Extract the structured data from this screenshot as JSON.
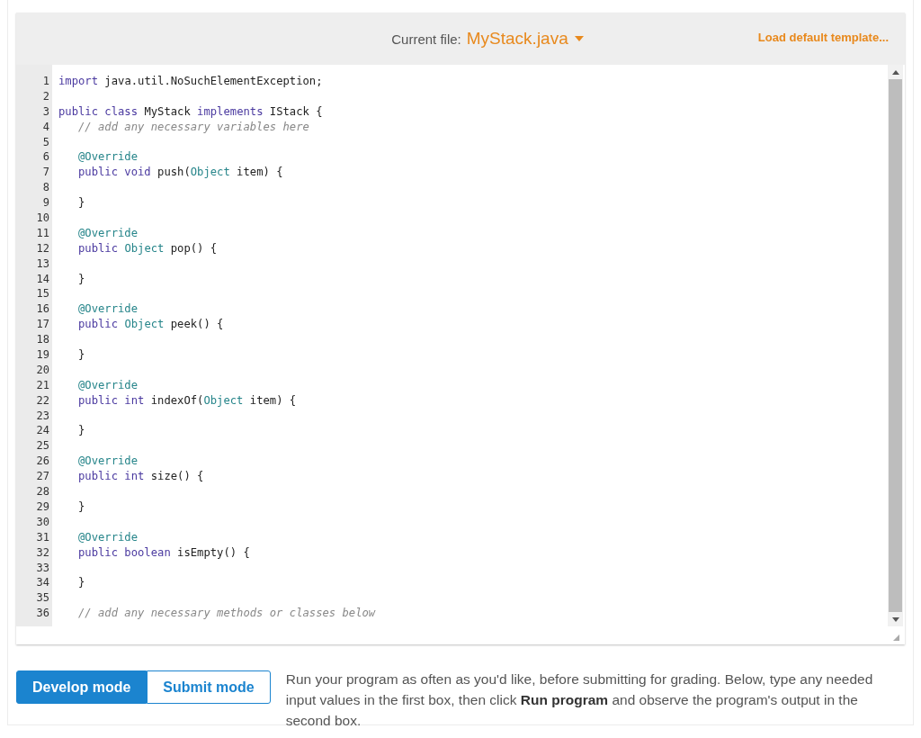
{
  "header": {
    "label": "Current file:",
    "file": "MyStack.java",
    "load_link": "Load default template..."
  },
  "code_lines": [
    {
      "number": "1",
      "tokens": [
        {
          "kind": "keyword",
          "text": "import"
        },
        {
          "kind": "text",
          "text": " java.util.NoSuchElementException;"
        }
      ]
    },
    {
      "number": "2"
    },
    {
      "number": "3",
      "tokens": [
        {
          "kind": "keyword",
          "text": "public class"
        },
        {
          "kind": "text",
          "text": " MyStack "
        },
        {
          "kind": "keyword",
          "text": "implements"
        },
        {
          "kind": "text",
          "text": " IStack {"
        }
      ]
    },
    {
      "number": "4",
      "indent": true,
      "tokens": [
        {
          "kind": "comment",
          "text": "// add any necessary variables here"
        }
      ]
    },
    {
      "number": "5"
    },
    {
      "number": "6",
      "indent": true,
      "tokens": [
        {
          "kind": "meta",
          "text": "@Override"
        }
      ]
    },
    {
      "number": "7",
      "indent": true,
      "tokens": [
        {
          "kind": "keyword",
          "text": "public void"
        },
        {
          "kind": "text",
          "text": " push("
        },
        {
          "kind": "type",
          "text": "Object"
        },
        {
          "kind": "text",
          "text": " item) {"
        }
      ]
    },
    {
      "number": "8"
    },
    {
      "number": "9",
      "indent": true,
      "tokens": [
        {
          "kind": "text",
          "text": "}"
        }
      ]
    },
    {
      "number": "10"
    },
    {
      "number": "11",
      "indent": true,
      "tokens": [
        {
          "kind": "meta",
          "text": "@Override"
        }
      ]
    },
    {
      "number": "12",
      "indent": true,
      "tokens": [
        {
          "kind": "keyword",
          "text": "public "
        },
        {
          "kind": "type",
          "text": "Object"
        },
        {
          "kind": "text",
          "text": " pop() {"
        }
      ]
    },
    {
      "number": "13"
    },
    {
      "number": "14",
      "indent": true,
      "tokens": [
        {
          "kind": "text",
          "text": "}"
        }
      ]
    },
    {
      "number": "15"
    },
    {
      "number": "16",
      "indent": true,
      "tokens": [
        {
          "kind": "meta",
          "text": "@Override"
        }
      ]
    },
    {
      "number": "17",
      "indent": true,
      "tokens": [
        {
          "kind": "keyword",
          "text": "public "
        },
        {
          "kind": "type",
          "text": "Object"
        },
        {
          "kind": "text",
          "text": " peek() {"
        }
      ]
    },
    {
      "number": "18"
    },
    {
      "number": "19",
      "indent": true,
      "tokens": [
        {
          "kind": "text",
          "text": "}"
        }
      ]
    },
    {
      "number": "20"
    },
    {
      "number": "21",
      "indent": true,
      "tokens": [
        {
          "kind": "meta",
          "text": "@Override"
        }
      ]
    },
    {
      "number": "22",
      "indent": true,
      "tokens": [
        {
          "kind": "keyword",
          "text": "public int"
        },
        {
          "kind": "text",
          "text": " indexOf("
        },
        {
          "kind": "type",
          "text": "Object"
        },
        {
          "kind": "text",
          "text": " item) {"
        }
      ]
    },
    {
      "number": "23"
    },
    {
      "number": "24",
      "indent": true,
      "tokens": [
        {
          "kind": "text",
          "text": "}"
        }
      ]
    },
    {
      "number": "25"
    },
    {
      "number": "26",
      "indent": true,
      "tokens": [
        {
          "kind": "meta",
          "text": "@Override"
        }
      ]
    },
    {
      "number": "27",
      "indent": true,
      "tokens": [
        {
          "kind": "keyword",
          "text": "public int"
        },
        {
          "kind": "text",
          "text": " size() {"
        }
      ]
    },
    {
      "number": "28"
    },
    {
      "number": "29",
      "indent": true,
      "tokens": [
        {
          "kind": "text",
          "text": "}"
        }
      ]
    },
    {
      "number": "30"
    },
    {
      "number": "31",
      "indent": true,
      "tokens": [
        {
          "kind": "meta",
          "text": "@Override"
        }
      ]
    },
    {
      "number": "32",
      "indent": true,
      "tokens": [
        {
          "kind": "keyword",
          "text": "public boolean"
        },
        {
          "kind": "text",
          "text": " isEmpty() {"
        }
      ]
    },
    {
      "number": "33"
    },
    {
      "number": "34",
      "indent": true,
      "tokens": [
        {
          "kind": "text",
          "text": "}"
        }
      ]
    },
    {
      "number": "35"
    },
    {
      "number": "36",
      "indent": true,
      "tokens": [
        {
          "kind": "comment",
          "text": "// add any necessary methods or classes below"
        }
      ]
    }
  ],
  "modes": [
    {
      "label": "Develop mode",
      "selected": true
    },
    {
      "label": "Submit mode",
      "selected": false
    }
  ],
  "instructions": "Run your program as often as you'd like, before submitting for grading. Below, type any needed input values in the first box, then click **Run program** and observe the program's output in the second box."
}
